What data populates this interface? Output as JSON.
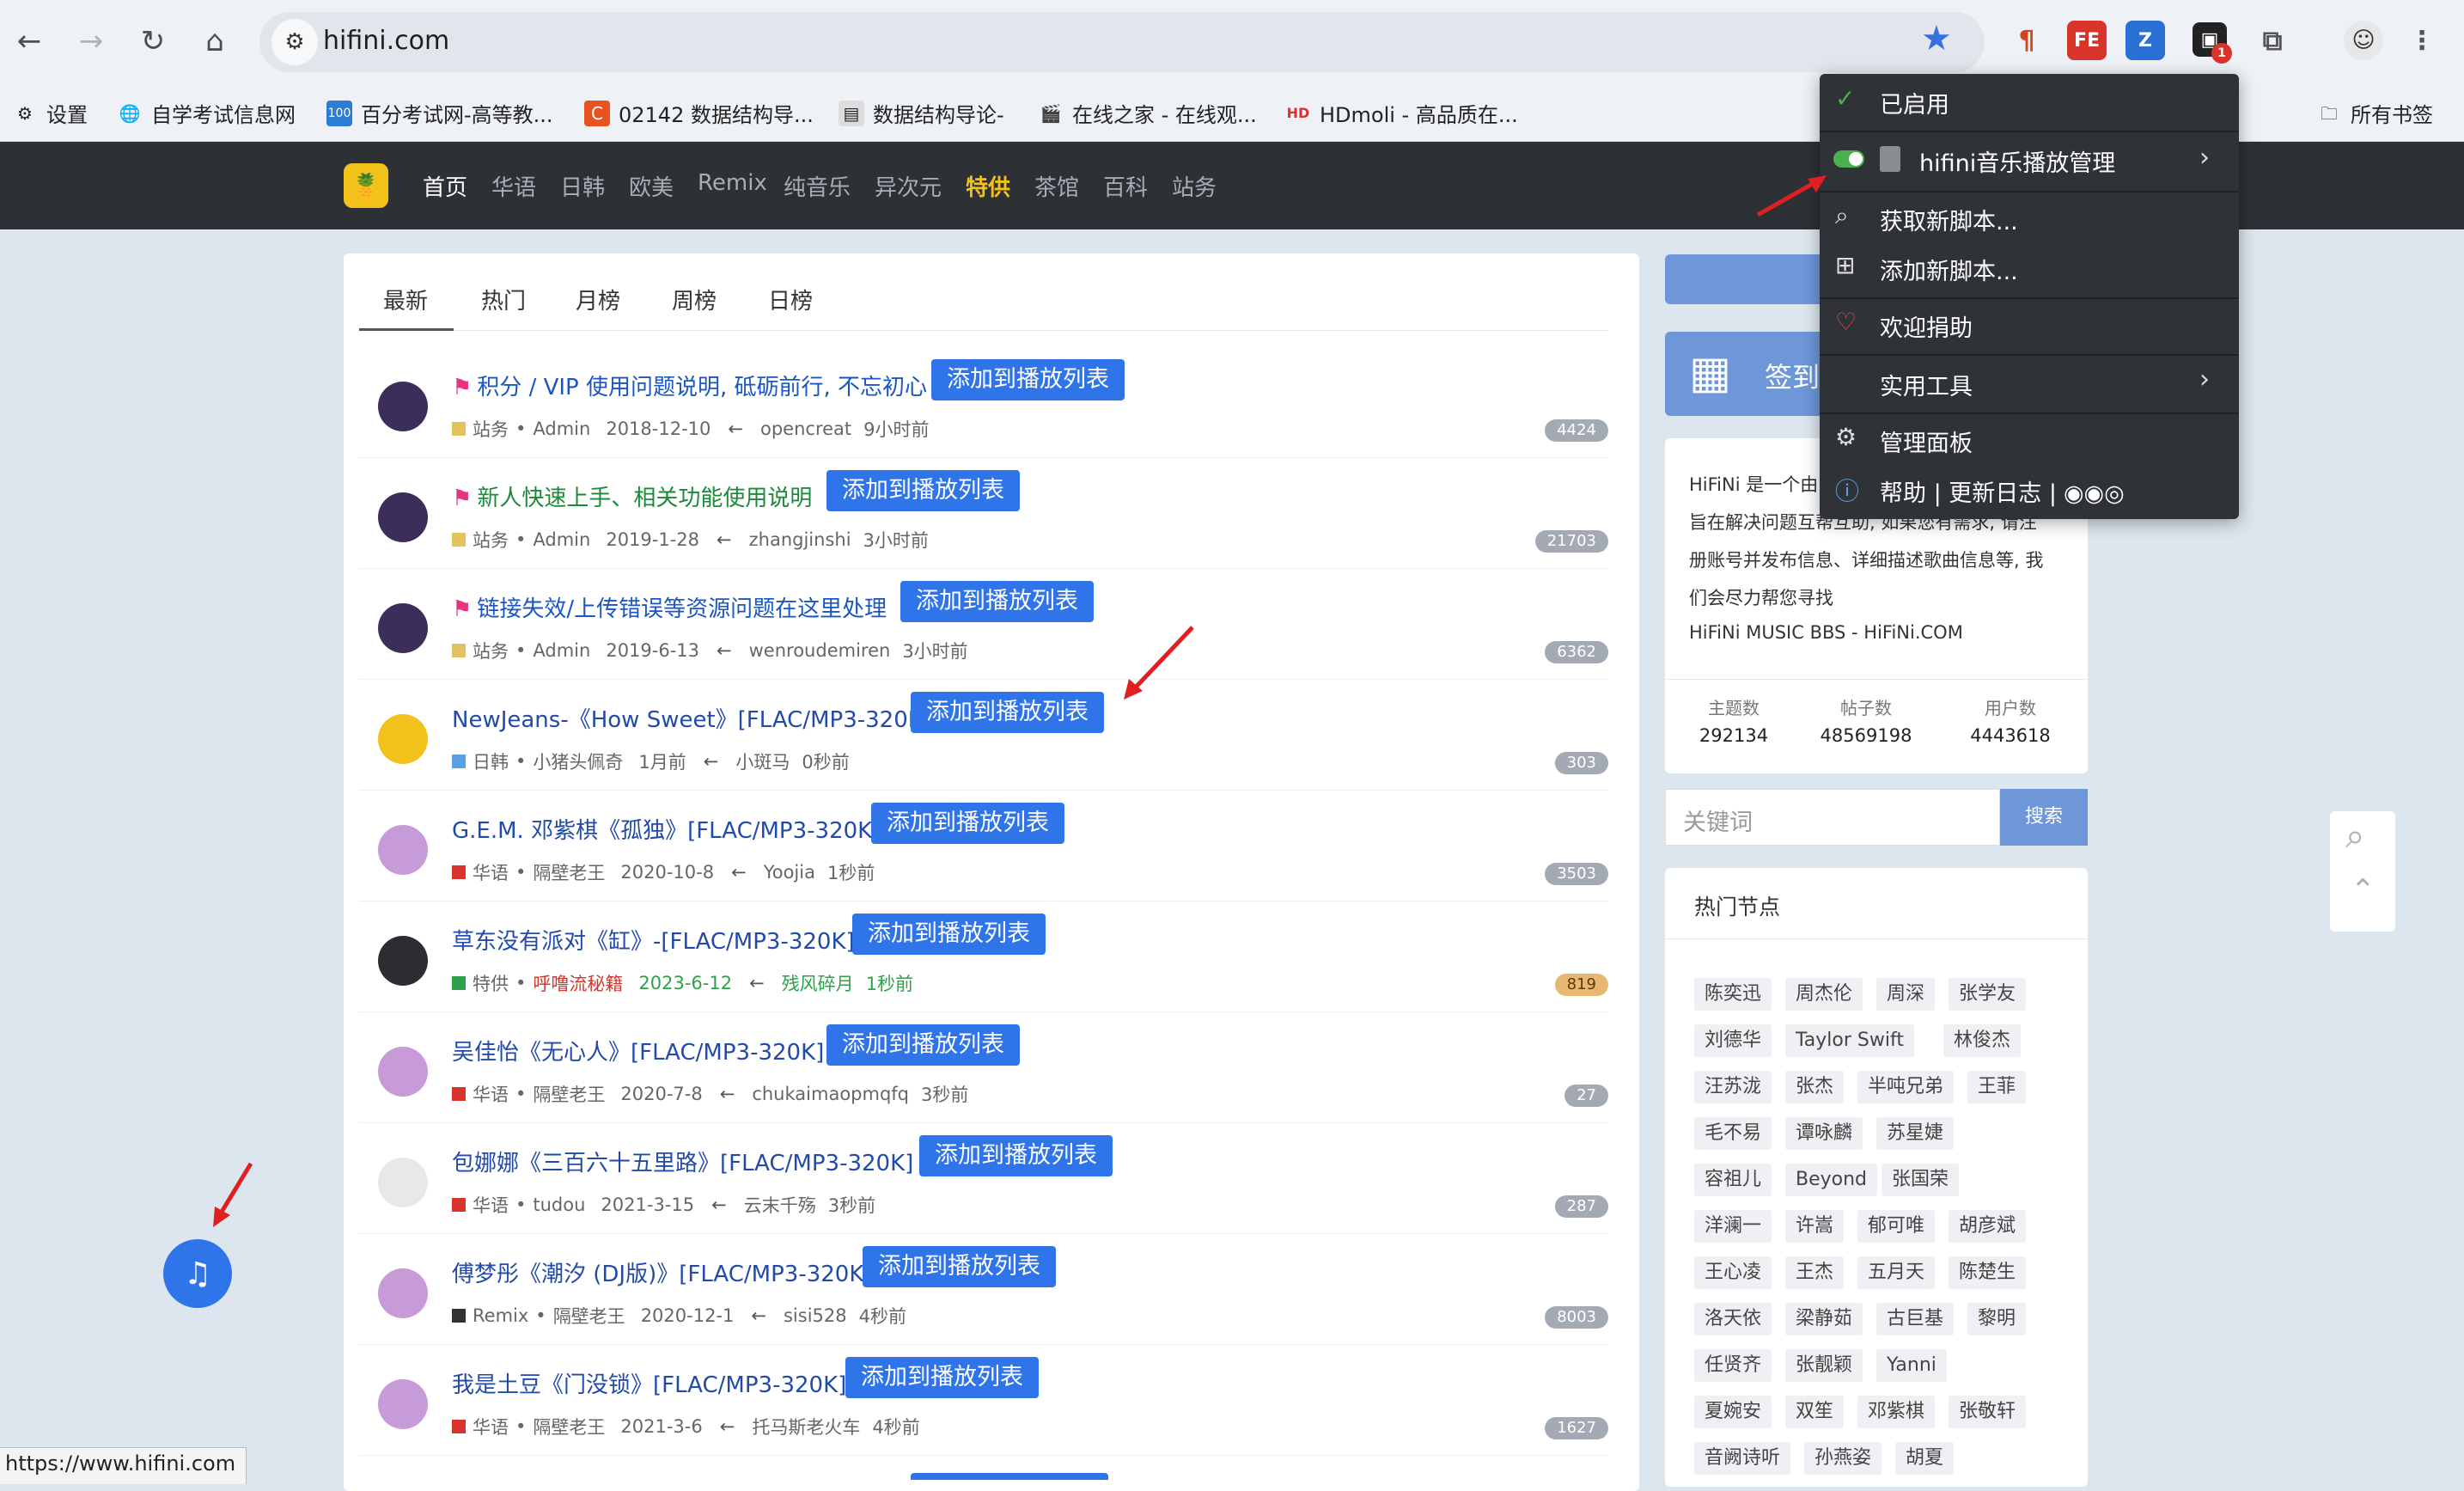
{
  "browser": {
    "url": "hifini.com",
    "status_url": "https://www.hifini.com"
  },
  "bookmarks": [
    "设置",
    "自学考试信息网",
    "百分考试网-高等教...",
    "02142 数据结构导...",
    "数据结构导论-",
    "在线之家 - 在线观...",
    "HDmoli - 高品质在...",
    "所有书签"
  ],
  "site_nav": [
    "首页",
    "华语",
    "日韩",
    "欧美",
    "Remix",
    "纯音乐",
    "异次元",
    "特供",
    "茶馆",
    "百科",
    "站务"
  ],
  "tabs": [
    "最新",
    "热门",
    "月榜",
    "周榜",
    "日榜"
  ],
  "add_label": "添加到播放列表",
  "threads": [
    {
      "title": "积分 / VIP 使用问题说明, 砥砺前行, 不忘初心",
      "cat": "站务",
      "author": "Admin",
      "date": "2018-12-10",
      "last": "opencreat",
      "ago": "9小时前",
      "count": "4424"
    },
    {
      "title": "新人快速上手、相关功能使用说明",
      "cat": "站务",
      "author": "Admin",
      "date": "2019-1-28",
      "last": "zhangjinshi",
      "ago": "3小时前",
      "count": "21703"
    },
    {
      "title": "链接失效/上传错误等资源问题在这里处理",
      "cat": "站务",
      "author": "Admin",
      "date": "2019-6-13",
      "last": "wenroudemiren",
      "ago": "3小时前",
      "count": "6362"
    },
    {
      "title": "NewJeans-《How Sweet》[FLAC/MP3-320K]",
      "cat": "日韩",
      "author": "小猪头佩奇",
      "date": "1月前",
      "last": "小斑马",
      "ago": "0秒前",
      "count": "303"
    },
    {
      "title": "G.E.M. 邓紫棋《孤独》[FLAC/MP3-320K]",
      "cat": "华语",
      "author": "隔壁老王",
      "date": "2020-10-8",
      "last": "Yoojia",
      "ago": "1秒前",
      "count": "3503"
    },
    {
      "title": "草东没有派对《缸》-[FLAC/MP3-320K]",
      "cat": "特供",
      "author": "呼噜流秘籍",
      "date": "2023-6-12",
      "last": "残风碎月",
      "ago": "1秒前",
      "count": "819"
    },
    {
      "title": "吴佳怡《无心人》[FLAC/MP3-320K]",
      "cat": "华语",
      "author": "隔壁老王",
      "date": "2020-7-8",
      "last": "chukaimaopmqfq",
      "ago": "3秒前",
      "count": "27"
    },
    {
      "title": "包娜娜《三百六十五里路》[FLAC/MP3-320K]",
      "cat": "华语",
      "author": "tudou",
      "date": "2021-3-15",
      "last": "云末千殇",
      "ago": "3秒前",
      "count": "287"
    },
    {
      "title": "傅梦彤《潮汐 (DJ版)》[FLAC/MP3-320K]",
      "cat": "Remix",
      "author": "隔壁老王",
      "date": "2020-12-1",
      "last": "sisi528",
      "ago": "4秒前",
      "count": "8003"
    },
    {
      "title": "我是土豆《门没锁》[FLAC/MP3-320K]",
      "cat": "华语",
      "author": "隔壁老王",
      "date": "2021-3-6",
      "last": "托马斯老火车",
      "ago": "4秒前",
      "count": "1627"
    }
  ],
  "sidebar": {
    "signin": "签到",
    "about_lines": [
      "HiFiNi 是一个由",
      "旨在解决问题互帮互助, 如果您有需求, 请注",
      "册账号并发布信息、详细描述歌曲信息等, 我",
      "们会尽力帮您寻找",
      "HiFiNi MUSIC BBS - HiFiNi.COM"
    ],
    "stats": [
      {
        "label": "主题数",
        "value": "292134"
      },
      {
        "label": "帖子数",
        "value": "48569198"
      },
      {
        "label": "用户数",
        "value": "4443618"
      }
    ],
    "search_placeholder": "关键词",
    "search_btn": "搜索",
    "hot_title": "热门节点",
    "hot_tags": [
      [
        "陈奕迅",
        "周杰伦",
        "周深",
        "张学友"
      ],
      [
        "刘德华",
        "Taylor Swift",
        "林俊杰"
      ],
      [
        "汪苏泷",
        "张杰",
        "半吨兄弟",
        "王菲"
      ],
      [
        "毛不易",
        "谭咏麟",
        "苏星婕"
      ],
      [
        "容祖儿",
        "Beyond",
        "张国荣"
      ],
      [
        "洋澜一",
        "许嵩",
        "郁可唯",
        "胡彦斌"
      ],
      [
        "王心凌",
        "王杰",
        "五月天",
        "陈楚生"
      ],
      [
        "洛天依",
        "梁静茹",
        "古巨基",
        "黎明"
      ],
      [
        "任贤齐",
        "张靓颖",
        "Yanni"
      ],
      [
        "夏婉安",
        "双笙",
        "邓紫棋",
        "张敬轩"
      ],
      [
        "音阙诗听",
        "孙燕姿",
        "胡夏"
      ]
    ]
  },
  "dropdown": {
    "enabled": "已启用",
    "script": "hifini音乐播放管理",
    "get": "获取新脚本...",
    "add": "添加新脚本...",
    "donate": "欢迎捐助",
    "tools": "实用工具",
    "panel": "管理面板",
    "help": "帮助 | 更新日志 |"
  }
}
